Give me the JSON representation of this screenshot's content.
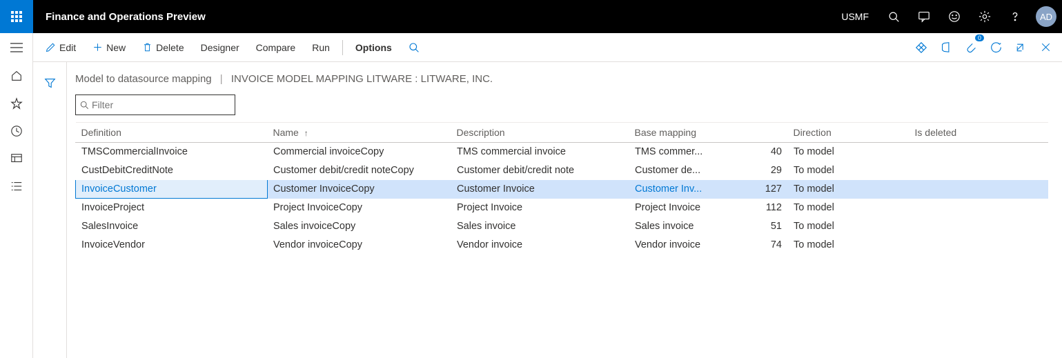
{
  "header": {
    "app_title": "Finance and Operations Preview",
    "company": "USMF",
    "avatar": "AD"
  },
  "actions": {
    "edit": "Edit",
    "new": "New",
    "delete": "Delete",
    "designer": "Designer",
    "compare": "Compare",
    "run": "Run",
    "options": "Options",
    "attachment_count": "0"
  },
  "breadcrumb": {
    "part1": "Model to datasource mapping",
    "part2": "INVOICE MODEL MAPPING LITWARE : LITWARE, INC."
  },
  "filter": {
    "placeholder": "Filter"
  },
  "columns": {
    "definition": "Definition",
    "name": "Name",
    "description": "Description",
    "base_mapping": "Base mapping",
    "unnamed_num": "",
    "direction": "Direction",
    "is_deleted": "Is deleted"
  },
  "rows": [
    {
      "definition": "TMSCommercialInvoice",
      "name": "Commercial invoiceCopy",
      "description": "TMS commercial invoice",
      "base_mapping": "TMS commer...",
      "num": "40",
      "direction": "To model",
      "is_deleted": "",
      "selected": false
    },
    {
      "definition": "CustDebitCreditNote",
      "name": "Customer debit/credit noteCopy",
      "description": "Customer debit/credit note",
      "base_mapping": "Customer de...",
      "num": "29",
      "direction": "To model",
      "is_deleted": "",
      "selected": false
    },
    {
      "definition": "InvoiceCustomer",
      "name": "Customer InvoiceCopy",
      "description": "Customer Invoice",
      "base_mapping": "Customer Inv...",
      "num": "127",
      "direction": "To model",
      "is_deleted": "",
      "selected": true
    },
    {
      "definition": "InvoiceProject",
      "name": "Project InvoiceCopy",
      "description": "Project Invoice",
      "base_mapping": "Project Invoice",
      "num": "112",
      "direction": "To model",
      "is_deleted": "",
      "selected": false
    },
    {
      "definition": "SalesInvoice",
      "name": "Sales invoiceCopy",
      "description": "Sales invoice",
      "base_mapping": "Sales invoice",
      "num": "51",
      "direction": "To model",
      "is_deleted": "",
      "selected": false
    },
    {
      "definition": "InvoiceVendor",
      "name": "Vendor invoiceCopy",
      "description": "Vendor invoice",
      "base_mapping": "Vendor invoice",
      "num": "74",
      "direction": "To model",
      "is_deleted": "",
      "selected": false
    }
  ]
}
